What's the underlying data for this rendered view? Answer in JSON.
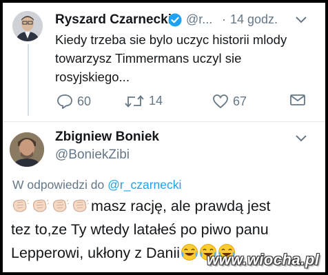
{
  "tweet1": {
    "author_name": "Ryszard Czarnecki",
    "handle_truncated": "@r...",
    "separator": "·",
    "time": "14 godz.",
    "text": "Kiedy trzeba sie bylo uczyc historii mlody towarzysz Timmermans uczyl sie rosyjskiego...",
    "reply_count": "60",
    "retweet_count": "14",
    "like_count": "67"
  },
  "tweet2": {
    "author_name": "Zbigniew Boniek",
    "handle": "@BoniekZibi",
    "reply_prefix": "W odpowiedzi do",
    "reply_mention": "@r_czarnecki",
    "text_line1": "masz rację, ale prawdą jest",
    "text_line2": "tez to,ze Ty wtedy latałeś po piwo panu",
    "text_line3": "Lepperowi, ukłony z Danii"
  },
  "watermark": "www.wiocha.pl",
  "colors": {
    "primary_text": "#14171a",
    "secondary_text": "#657786",
    "link": "#1da1f2",
    "verified": "#1da1f2",
    "divider": "#e1e8ed"
  },
  "icons": [
    "verified-badge-icon",
    "chevron-down-icon",
    "reply-icon",
    "retweet-icon",
    "like-icon",
    "direct-message-icon",
    "clapping-hands-emoji",
    "tears-of-joy-emoji"
  ]
}
